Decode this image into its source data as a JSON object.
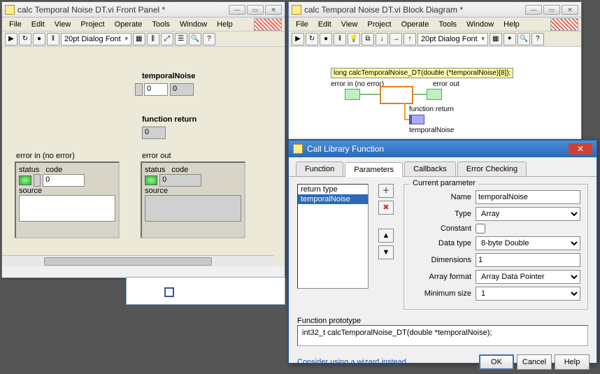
{
  "front": {
    "title": "calc Temporal Noise DT.vi Front Panel *",
    "menu": [
      "File",
      "Edit",
      "View",
      "Project",
      "Operate",
      "Tools",
      "Window",
      "Help"
    ],
    "font": "20pt Dialog Font",
    "labels": {
      "temporalNoise": "temporalNoise",
      "functionReturn": "function return",
      "errorIn": "error in (no error)",
      "errorOut": "error out",
      "status": "status",
      "code": "code",
      "source": "source"
    },
    "values": {
      "tnIndex": "0",
      "tnVal": "0",
      "funcRet": "0",
      "errInCode": "0",
      "errOutCode": "0"
    }
  },
  "block": {
    "title": "calc Temporal Noise DT.vi Block Diagram *",
    "menu": [
      "File",
      "Edit",
      "View",
      "Project",
      "Operate",
      "Tools",
      "Window",
      "Help"
    ],
    "font": "20pt Dialog Font",
    "tip": "long calcTemporalNoise_DT(double (*temporalNoise)[8]);",
    "errInLbl": "error in (no error)",
    "errOutLbl": "error out",
    "funcRetLbl": "function return",
    "tnLbl": "temporalNoise"
  },
  "dialog": {
    "title": "Call Library Function",
    "tabs": [
      "Function",
      "Parameters",
      "Callbacks",
      "Error Checking"
    ],
    "activeTab": 1,
    "paramList": [
      "return type",
      "temporalNoise"
    ],
    "paramSelected": 1,
    "groupLegend": "Current parameter",
    "fields": {
      "nameLbl": "Name",
      "typeLbl": "Type",
      "constantLbl": "Constant",
      "dataTypeLbl": "Data type",
      "dimensionsLbl": "Dimensions",
      "arrayFmtLbl": "Array format",
      "minSizeLbl": "Minimum size"
    },
    "values": {
      "name": "temporalNoise",
      "type": "Array",
      "constant": false,
      "dataType": "8-byte Double",
      "dimensions": "1",
      "arrayFmt": "Array Data Pointer",
      "minSize": "1"
    },
    "protoLbl": "Function prototype",
    "proto": "int32_t calcTemporalNoise_DT(double *temporalNoise);",
    "wizardLink": "Consider using a wizard instead...",
    "buttons": {
      "ok": "OK",
      "cancel": "Cancel",
      "help": "Help"
    }
  }
}
